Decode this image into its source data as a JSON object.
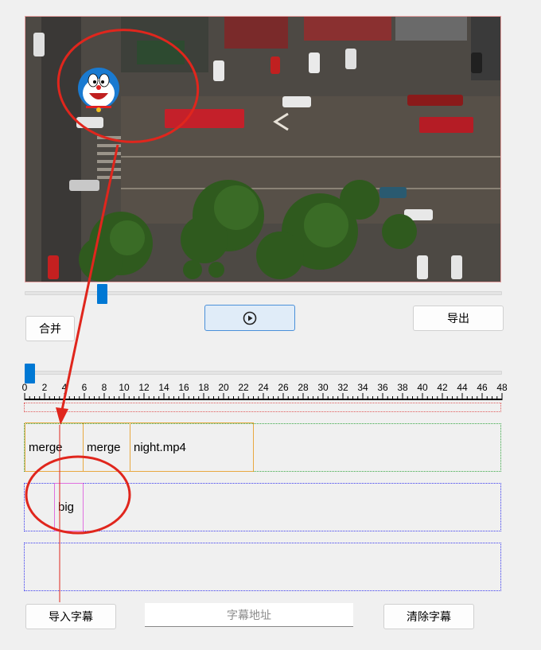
{
  "video": {
    "overlay_sticker": "doraemon-sticker"
  },
  "controls": {
    "merge_label": "合并",
    "export_label": "导出",
    "play_icon": "play-circle-icon"
  },
  "timeline": {
    "ticks": [
      "0",
      "2",
      "4",
      "6",
      "8",
      "10",
      "12",
      "14",
      "16",
      "18",
      "20",
      "22",
      "24",
      "26",
      "28",
      "30",
      "32",
      "34",
      "36",
      "38",
      "40",
      "42",
      "44",
      "46",
      "48"
    ]
  },
  "video_track": {
    "clips": [
      {
        "label": "merge"
      },
      {
        "label": "merge"
      },
      {
        "label": "night.mp4"
      }
    ]
  },
  "subtitle_track": {
    "clips": [
      {
        "label": "big"
      }
    ]
  },
  "bottom": {
    "import_label": "导入字幕",
    "subtitle_path_placeholder": "字幕地址",
    "clear_label": "清除字幕"
  },
  "colors": {
    "accent": "#0078d4",
    "annotation": "#e0261d",
    "clip_border": "#e8a840",
    "subtitle_border": "#e070e0"
  }
}
